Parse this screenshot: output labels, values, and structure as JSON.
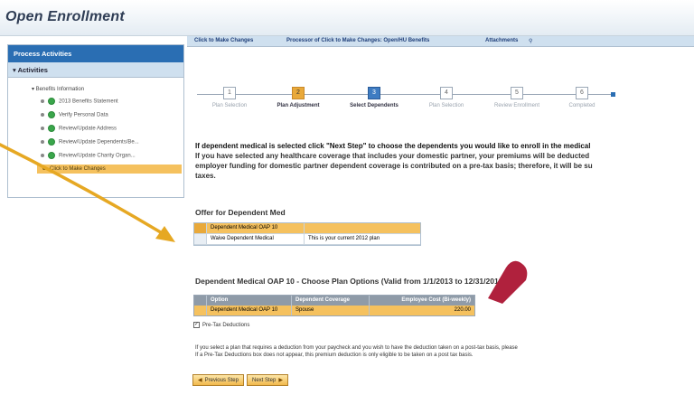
{
  "app": {
    "title": "Open Enrollment"
  },
  "sidebar": {
    "header": "Process Activities",
    "subheader": "▾  Activities",
    "root_label": "▾ Benefits Information",
    "items": [
      {
        "label": "2013 Benefits Statement",
        "status": "complete"
      },
      {
        "label": "Verify Personal Data",
        "status": "complete"
      },
      {
        "label": "Review/Update Address",
        "status": "complete"
      },
      {
        "label": "Review/Update Dependents/Be...",
        "status": "complete"
      },
      {
        "label": "Review/Update Charity Organ...",
        "status": "complete"
      },
      {
        "label": "Click to Make Changes",
        "status": "active"
      }
    ]
  },
  "topbar": {
    "link": "Click to Make Changes",
    "process": "Processor of Click to Make Changes: Open/HU Benefits",
    "attachments": "Attachments"
  },
  "roadmap": {
    "steps": [
      {
        "num": "1",
        "label": "Plan Selection",
        "state": "pending"
      },
      {
        "num": "2",
        "label": "Plan Adjustment",
        "state": "done"
      },
      {
        "num": "3",
        "label": "Select Dependents",
        "state": "current"
      },
      {
        "num": "4",
        "label": "Plan Selection",
        "state": "pending"
      },
      {
        "num": "5",
        "label": "Review Enrollment",
        "state": "pending"
      },
      {
        "num": "6",
        "label": "Completed",
        "state": "pending"
      }
    ]
  },
  "instructions": {
    "line1": "If dependent medical is selected click \"Next Step\" to choose the dependents you would like to enroll in the medical",
    "line2": "If you have selected any healthcare coverage that includes your domestic partner, your premiums will be deducted",
    "line3": "employer funding for domestic partner dependent coverage is contributed on a pre-tax basis; therefore, it will be su",
    "line4": "taxes."
  },
  "offer": {
    "title": "Offer for Dependent Med",
    "rows": [
      {
        "col1": "Dependent Medical OAP 10",
        "col2": "",
        "selected": true
      },
      {
        "col1": "Waive Dependent Medical",
        "col2": "This is your current 2012 plan",
        "selected": false
      }
    ]
  },
  "plan_options": {
    "title": "Dependent Medical OAP 10 - Choose Plan Options (Valid from 1/1/2013 to 12/31/2013)",
    "columns": [
      "Option",
      "Dependent Coverage",
      "Employee Cost (Bi-weekly)"
    ],
    "rows": [
      {
        "option": "Dependent Medical OAP 10",
        "coverage": "Spouse",
        "cost": "220.00"
      }
    ],
    "pretax_label": "Pre-Tax Deductions",
    "pretax_checked": true
  },
  "note": {
    "line1": "If you select a plan that requires a deduction from your paycheck and you wish to have the deduction taken on a post-tax basis, please",
    "line2": "If a Pre-Tax Deductions box does not appear, this premium deduction is only eligible to be taken on a post tax basis."
  },
  "buttons": {
    "previous": "Previous Step",
    "next": "Next Step"
  },
  "colors": {
    "accent_blue": "#2a6eb3",
    "highlight_orange": "#f5c15e",
    "annotation_arrow": "#e6a823",
    "cursor_red": "#b0213d"
  }
}
